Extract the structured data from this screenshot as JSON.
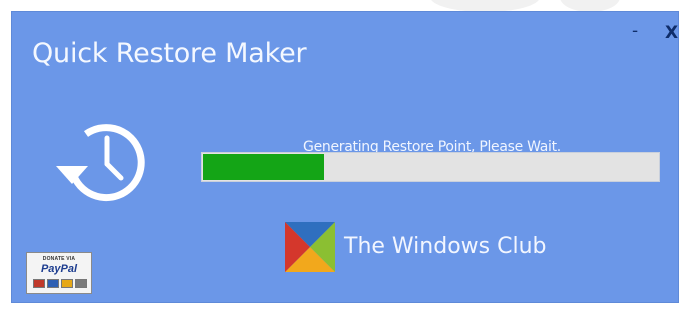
{
  "window": {
    "title": "Quick Restore Maker",
    "minimize_glyph": "-",
    "close_glyph": "X",
    "background_color": "#6b97e8"
  },
  "progress": {
    "status_text": "Generating Restore Point, Please Wait.",
    "value": 0.27,
    "fill_color": "#14a516",
    "track_color": "#e3e3e3"
  },
  "branding": {
    "name": "The Windows Club",
    "logo_icon": "windows-club-logo-icon"
  },
  "donate": {
    "small_text": "DONATE VIA",
    "brand_text": "PayPal",
    "card_colors": [
      "#c0392b",
      "#2e5fb3",
      "#e6a817",
      "#7a7a7a"
    ]
  },
  "icons": {
    "main": "history-icon"
  }
}
